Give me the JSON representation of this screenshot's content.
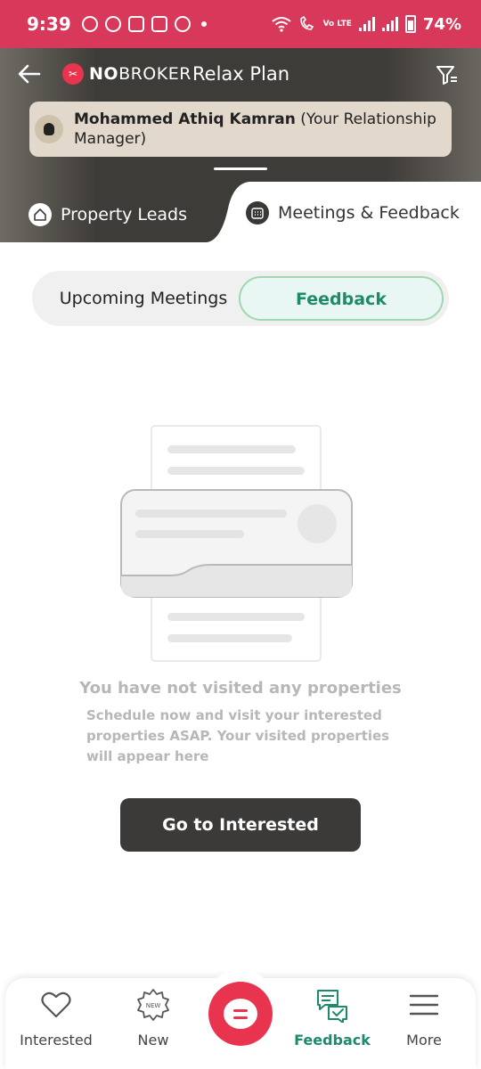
{
  "status_bar": {
    "time": "9:39",
    "volte": "Vo LTE",
    "battery": "74%",
    "color": "#d8395a"
  },
  "header": {
    "brand_prefix": "NO",
    "brand_suffix": "BROKER",
    "plan_title": "Relax Plan",
    "relationship_manager_name": "Mohammed Athiq Kamran",
    "relationship_manager_role": "(Your Relationship Manager)"
  },
  "tabs": [
    {
      "label": "Property Leads",
      "icon": "home-icon",
      "active": false
    },
    {
      "label": "Meetings & Feedback",
      "icon": "calendar-icon",
      "active": true
    }
  ],
  "segment": {
    "upcoming_label": "Upcoming Meetings",
    "feedback_label": "Feedback",
    "selected": "Feedback"
  },
  "empty_state": {
    "title": "You have not visited any properties",
    "description": "Schedule now and visit your interested properties ASAP. Your visited properties will appear here",
    "cta_label": "Go to Interested"
  },
  "bottom_nav": [
    {
      "label": "Interested",
      "icon": "heart-icon",
      "active": false
    },
    {
      "label": "New",
      "icon": "new-badge-icon",
      "badge_text": "NEW",
      "active": false
    },
    {
      "label": "",
      "icon": "chat-fab-icon",
      "active": false
    },
    {
      "label": "Feedback",
      "icon": "feedback-icon",
      "active": true
    },
    {
      "label": "More",
      "icon": "menu-icon",
      "active": false
    }
  ],
  "colors": {
    "accent": "#e8344e",
    "active_green": "#1e8a6c",
    "dark": "#3c3a38"
  }
}
